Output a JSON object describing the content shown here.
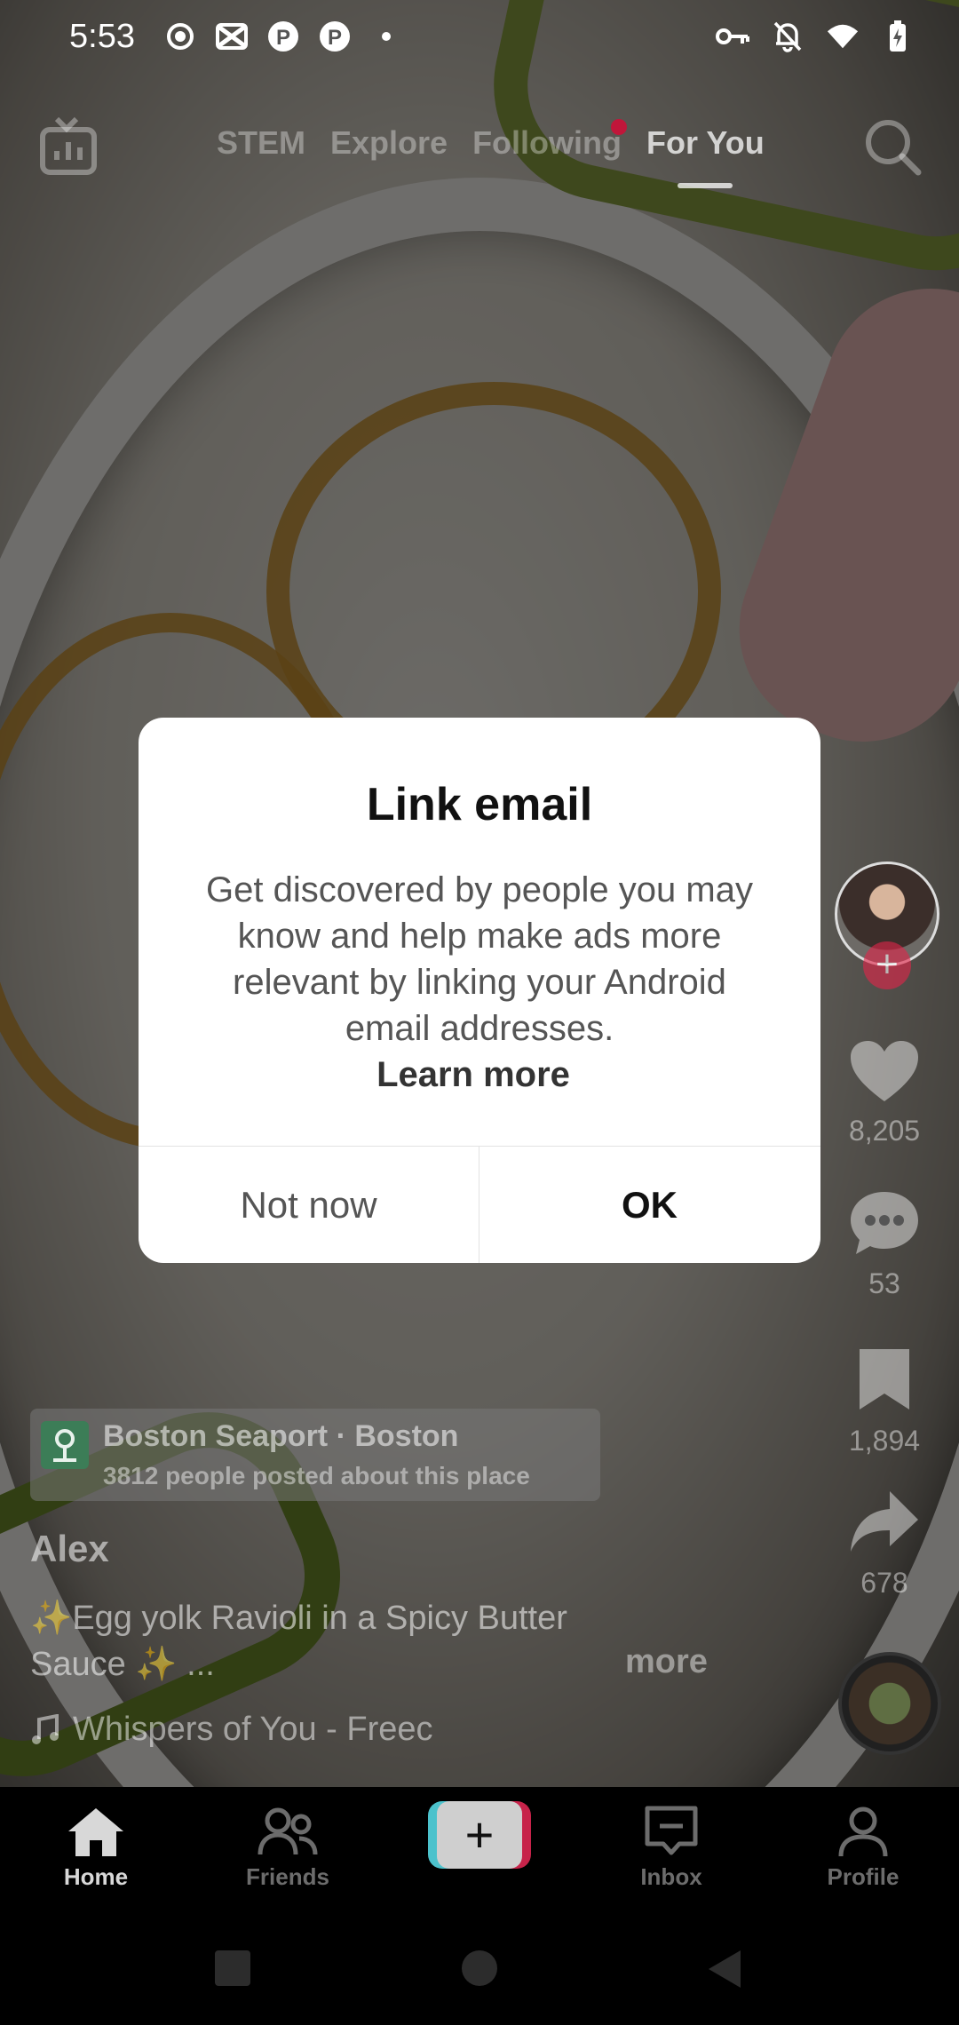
{
  "status_bar": {
    "time": "5:53",
    "left_icons": [
      "record-icon",
      "capcut-icon",
      "pinterest-icon",
      "pinterest-icon",
      "dot-icon"
    ],
    "right_icons": [
      "vpn-key-icon",
      "bell-off-icon",
      "wifi-icon",
      "battery-charging-icon"
    ]
  },
  "top_nav": {
    "tabs": [
      {
        "label": "STEM",
        "active": false
      },
      {
        "label": "Explore",
        "active": false
      },
      {
        "label": "Following",
        "active": false,
        "badge_dot": true
      },
      {
        "label": "For You",
        "active": true
      }
    ]
  },
  "rail": {
    "likes": "8,205",
    "comments": "53",
    "bookmarks": "1,894",
    "shares": "678"
  },
  "caption": {
    "place_name": "Boston Seaport · Boston",
    "place_sub": "3812 people posted about this place",
    "author": "Alex",
    "text": "✨Egg yolk Ravioli in a Spicy Butter Sauce ✨ ...",
    "more_label": "more",
    "sound": "Whispers of You - Freec"
  },
  "bottom_nav": {
    "home": "Home",
    "friends": "Friends",
    "create": "+",
    "inbox": "Inbox",
    "profile": "Profile"
  },
  "dialog": {
    "title": "Link email",
    "body": "Get discovered by people you may know and help make ads more relevant by linking your Android email addresses.",
    "link": "Learn more",
    "secondary_button": "Not now",
    "primary_button": "OK"
  },
  "colors": {
    "accent_red": "#e4254a",
    "create_cyan": "#4cc2cc",
    "dialog_bg": "#ffffff"
  }
}
